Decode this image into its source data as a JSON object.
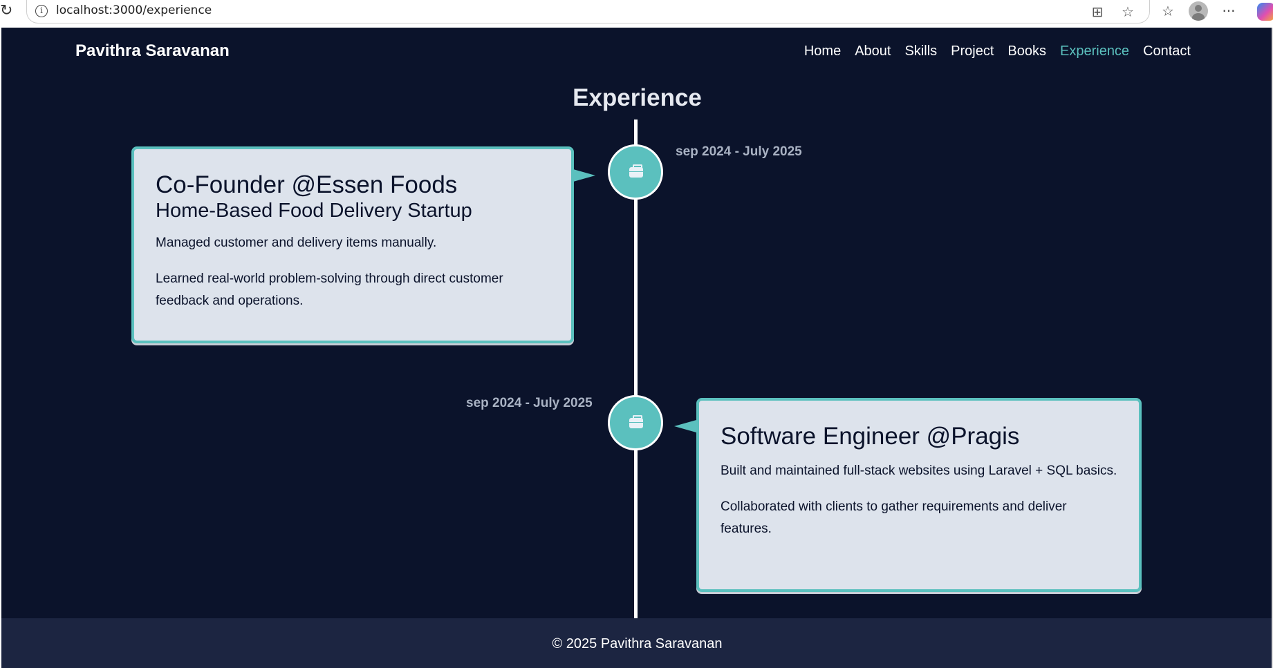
{
  "browser": {
    "url": "localhost:3000/experience"
  },
  "nav": {
    "brand": "Pavithra Saravanan",
    "links": [
      "Home",
      "About",
      "Skills",
      "Project",
      "Books",
      "Experience",
      "Contact"
    ],
    "active": "Experience"
  },
  "section": {
    "title": "Experience"
  },
  "experiences": [
    {
      "date": "sep 2024 - July 2025",
      "title": "Co-Founder @Essen Foods",
      "subtitle": "Home-Based Food Delivery Startup",
      "points": [
        "Managed customer and delivery items manually.",
        "Learned real-world problem-solving through direct customer feedback and operations."
      ]
    },
    {
      "date": "sep 2024 - July 2025",
      "title": "Software Engineer @Pragis",
      "points": [
        "Built and maintained full-stack websites using Laravel + SQL basics.",
        "Collaborated with clients to gather requirements and deliver features."
      ]
    }
  ],
  "footer": {
    "text": "© 2025 Pavithra Saravanan"
  },
  "colors": {
    "background": "#0b132b",
    "accent": "#5bc0be",
    "card": "#dde3ec",
    "footer": "#1c2541"
  }
}
